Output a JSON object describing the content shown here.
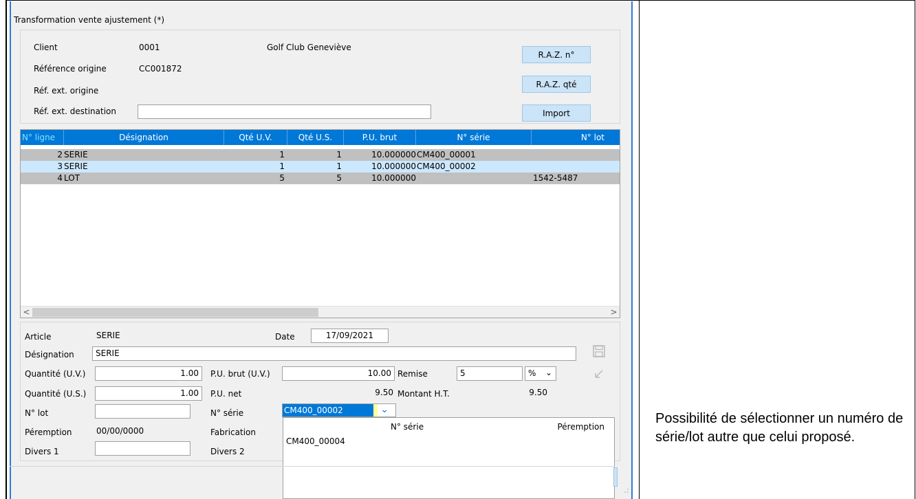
{
  "window": {
    "title": "Transformation vente ajustement (*)"
  },
  "header": {
    "client_label": "Client",
    "client_code": "0001",
    "client_name": "Golf Club Geneviève",
    "ref_origine_label": "Référence origine",
    "ref_origine_value": "CC001872",
    "ref_ext_origine_label": "Réf. ext. origine",
    "ref_ext_dest_label": "Réf. ext. destination",
    "ref_ext_dest_value": "",
    "raz_num_label": "R.A.Z. n°",
    "raz_qte_label": "R.A.Z. qté",
    "import_label": "Import"
  },
  "grid": {
    "columns": [
      "N° ligne",
      "Désignation",
      "Qté U.V.",
      "Qté U.S.",
      "P.U. brut",
      "N° série",
      "N° lot"
    ],
    "rows": [
      {
        "ligne": "2",
        "designation": "SERIE",
        "qte_uv": "1",
        "qte_us": "1",
        "pu_brut": "10.000000",
        "serie": "CM400_00001",
        "lot": ""
      },
      {
        "ligne": "3",
        "designation": "SERIE",
        "qte_uv": "1",
        "qte_us": "1",
        "pu_brut": "10.000000",
        "serie": "CM400_00002",
        "lot": ""
      },
      {
        "ligne": "4",
        "designation": "LOT",
        "qte_uv": "5",
        "qte_us": "5",
        "pu_brut": "10.000000",
        "serie": "",
        "lot": "1542-5487"
      }
    ],
    "scroll_left": "<",
    "scroll_right": ">"
  },
  "detail": {
    "article_label": "Article",
    "article_value": "SERIE",
    "date_label": "Date",
    "date_value": "17/09/2021",
    "designation_label": "Désignation",
    "designation_value": "SERIE",
    "qte_uv_label": "Quantité (U.V.)",
    "qte_uv_value": "1.00",
    "pu_brut_label": "P.U. brut (U.V.)",
    "pu_brut_value": "10.00",
    "remise_label": "Remise",
    "remise_value": "5",
    "remise_unit": "%",
    "qte_us_label": "Quantité (U.S.)",
    "qte_us_value": "1.00",
    "pu_net_label": "P.U. net",
    "pu_net_value": "9.50",
    "montant_label": "Montant H.T.",
    "montant_value": "9.50",
    "num_lot_label": "N° lot",
    "num_lot_value": "",
    "num_serie_label": "N° série",
    "num_serie_value": "CM400_00002",
    "peremption_label": "Péremption",
    "peremption_value": "00/00/0000",
    "fabrication_label": "Fabrication",
    "divers1_label": "Divers 1",
    "divers1_value": "",
    "divers2_label": "Divers 2"
  },
  "dropdown": {
    "col_serie": "N° série",
    "col_peremption": "Péremption",
    "items": [
      "CM400_00004"
    ]
  },
  "note": {
    "text": "Possibilité de sélectionner un numéro de série/lot autre que celui proposé."
  },
  "colors": {
    "grid_header": "#0078d7",
    "row_gray": "#c0c0c0",
    "row_selected": "#cce8ff",
    "button": "#cce4f7",
    "serie_highlight": "#0078d7"
  }
}
